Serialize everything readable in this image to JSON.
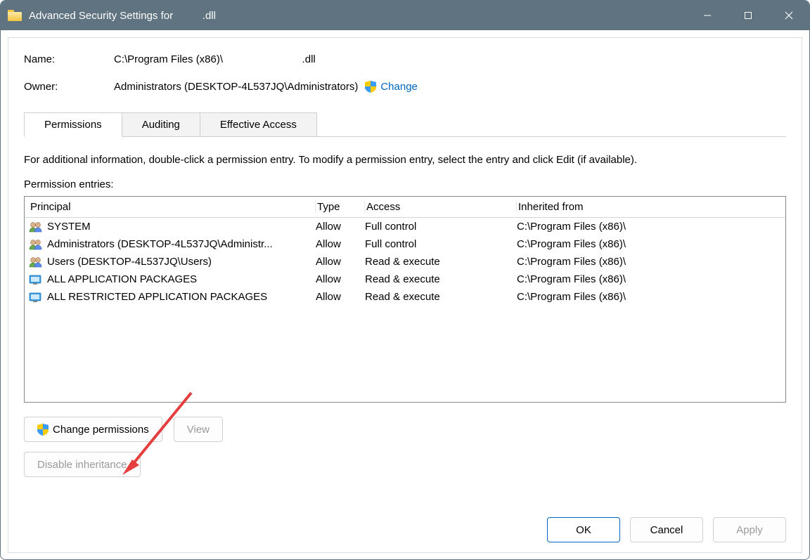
{
  "title_prefix": "Advanced Security Settings for",
  "title_gap": "          ",
  "title_suffix": ".dll",
  "name_label": "Name:",
  "name_value": "C:\\Program Files (x86)\\                           .dll",
  "owner_label": "Owner:",
  "owner_value": "Administrators (DESKTOP-4L537JQ\\Administrators)",
  "change_link": "Change",
  "tabs": {
    "permissions": "Permissions",
    "auditing": "Auditing",
    "effective": "Effective Access"
  },
  "hint": "For additional information, double-click a permission entry. To modify a permission entry, select the entry and click Edit (if available).",
  "entries_label": "Permission entries:",
  "columns": {
    "principal": "Principal",
    "type": "Type",
    "access": "Access",
    "inherited": "Inherited from"
  },
  "rows": [
    {
      "icon": "group",
      "principal": "SYSTEM",
      "type": "Allow",
      "access": "Full control",
      "inherited": "C:\\Program Files (x86)\\"
    },
    {
      "icon": "group",
      "principal": "Administrators (DESKTOP-4L537JQ\\Administr...",
      "type": "Allow",
      "access": "Full control",
      "inherited": "C:\\Program Files (x86)\\"
    },
    {
      "icon": "group",
      "principal": "Users (DESKTOP-4L537JQ\\Users)",
      "type": "Allow",
      "access": "Read & execute",
      "inherited": "C:\\Program Files (x86)\\"
    },
    {
      "icon": "pkg",
      "principal": "ALL APPLICATION PACKAGES",
      "type": "Allow",
      "access": "Read & execute",
      "inherited": "C:\\Program Files (x86)\\"
    },
    {
      "icon": "pkg",
      "principal": "ALL RESTRICTED APPLICATION PACKAGES",
      "type": "Allow",
      "access": "Read & execute",
      "inherited": "C:\\Program Files (x86)\\"
    }
  ],
  "buttons": {
    "change_permissions": "Change permissions",
    "view": "View",
    "disable_inheritance": "Disable inheritance",
    "ok": "OK",
    "cancel": "Cancel",
    "apply": "Apply"
  }
}
